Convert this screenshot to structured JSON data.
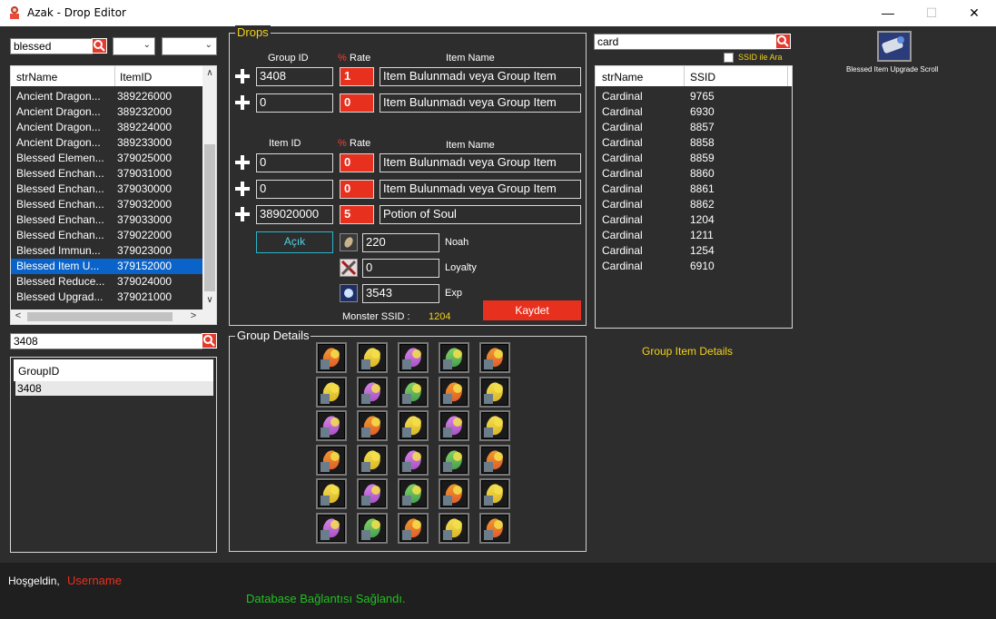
{
  "window": {
    "title": "Azak - Drop Editor",
    "minimize": "—",
    "maximize": "☐",
    "close": "✕"
  },
  "left_search": {
    "value": "blessed"
  },
  "item_list": {
    "headers": [
      "strName",
      "ItemID"
    ],
    "rows": [
      {
        "name": "Ancient Dragon...",
        "id": "389226000"
      },
      {
        "name": "Ancient Dragon...",
        "id": "389232000"
      },
      {
        "name": "Ancient Dragon...",
        "id": "389224000"
      },
      {
        "name": "Ancient Dragon...",
        "id": "389233000"
      },
      {
        "name": "Blessed Elemen...",
        "id": "379025000"
      },
      {
        "name": "Blessed Enchan...",
        "id": "379031000"
      },
      {
        "name": "Blessed Enchan...",
        "id": "379030000"
      },
      {
        "name": "Blessed Enchan...",
        "id": "379032000"
      },
      {
        "name": "Blessed Enchan...",
        "id": "379033000"
      },
      {
        "name": "Blessed Enchan...",
        "id": "379022000"
      },
      {
        "name": "Blessed Immun...",
        "id": "379023000"
      },
      {
        "name": "Blessed Item U...",
        "id": "379152000"
      },
      {
        "name": "Blessed Reduce...",
        "id": "379024000"
      },
      {
        "name": "Blessed Upgrad...",
        "id": "379021000"
      }
    ],
    "selected_index": 11,
    "scroll_up": "∧",
    "scroll_down": "∨",
    "scroll_left": "<",
    "scroll_right": ">"
  },
  "group_search": {
    "value": "3408"
  },
  "group_list": {
    "header": "GroupID",
    "rows": [
      "3408"
    ]
  },
  "drops": {
    "title": "Drops",
    "group_headers": {
      "id": "Group ID",
      "pct": "%",
      "rate": "Rate",
      "name": "Item Name"
    },
    "group_rows": [
      {
        "id": "3408",
        "rate": "1",
        "name": "Item Bulunmadı veya Group Item"
      },
      {
        "id": "0",
        "rate": "0",
        "name": "Item Bulunmadı veya Group Item"
      }
    ],
    "item_headers": {
      "id": "Item ID",
      "pct": "%",
      "rate": "Rate",
      "name": "Item Name"
    },
    "item_rows": [
      {
        "id": "0",
        "rate": "0",
        "name": "Item Bulunmadı veya Group Item"
      },
      {
        "id": "0",
        "rate": "0",
        "name": "Item Bulunmadı veya Group Item"
      },
      {
        "id": "389020000",
        "rate": "5",
        "name": "Potion of Soul"
      }
    ],
    "acik_label": "Açık",
    "noah": {
      "value": "220",
      "label": "Noah"
    },
    "loyalty": {
      "value": "0",
      "label": "Loyalty"
    },
    "exp": {
      "value": "3543",
      "label": "Exp"
    },
    "save_label": "Kaydet",
    "monster_ssid_label": "Monster SSID :",
    "monster_ssid_value": "1204"
  },
  "group_details": {
    "title": "Group Details",
    "tiles": [
      "orange",
      "yellow",
      "purple",
      "green",
      "orange",
      "yellow",
      "purple",
      "green",
      "orange",
      "yellow",
      "purple",
      "orange",
      "yellow",
      "purple",
      "yellow",
      "orange",
      "yellow",
      "purple",
      "green",
      "orange",
      "yellow",
      "purple",
      "green",
      "orange",
      "yellow",
      "purple",
      "green",
      "orange",
      "yellow",
      "orange"
    ]
  },
  "right_search": {
    "value": "card",
    "ssid_checkbox_label": "SSID ile Ara"
  },
  "monster_list": {
    "headers": [
      "strName",
      "SSID"
    ],
    "rows": [
      {
        "name": "Cardinal",
        "ssid": "9765"
      },
      {
        "name": "Cardinal",
        "ssid": "6930"
      },
      {
        "name": "Cardinal",
        "ssid": "8857"
      },
      {
        "name": "Cardinal",
        "ssid": "8858"
      },
      {
        "name": "Cardinal",
        "ssid": "8859"
      },
      {
        "name": "Cardinal",
        "ssid": "8860"
      },
      {
        "name": "Cardinal",
        "ssid": "8861"
      },
      {
        "name": "Cardinal",
        "ssid": "8862"
      },
      {
        "name": "Cardinal",
        "ssid": "1204"
      },
      {
        "name": "Cardinal",
        "ssid": "1211"
      },
      {
        "name": "Cardinal",
        "ssid": "1254"
      },
      {
        "name": "Cardinal",
        "ssid": "6910"
      }
    ]
  },
  "group_item_details_label": "Group Item Details",
  "preview_item": {
    "label": "Blessed Item Upgrade Scroll"
  },
  "status": {
    "welcome": "Hoşgeldin,",
    "username": "Username",
    "db_message": "Database Bağlantısı Sağlandı."
  },
  "colors": {
    "accent_red": "#e8301f",
    "selection_blue": "#0a63c9",
    "yellow_text": "#f3d21a",
    "green_text": "#1fc31f",
    "cyan": "#29b6c9"
  }
}
